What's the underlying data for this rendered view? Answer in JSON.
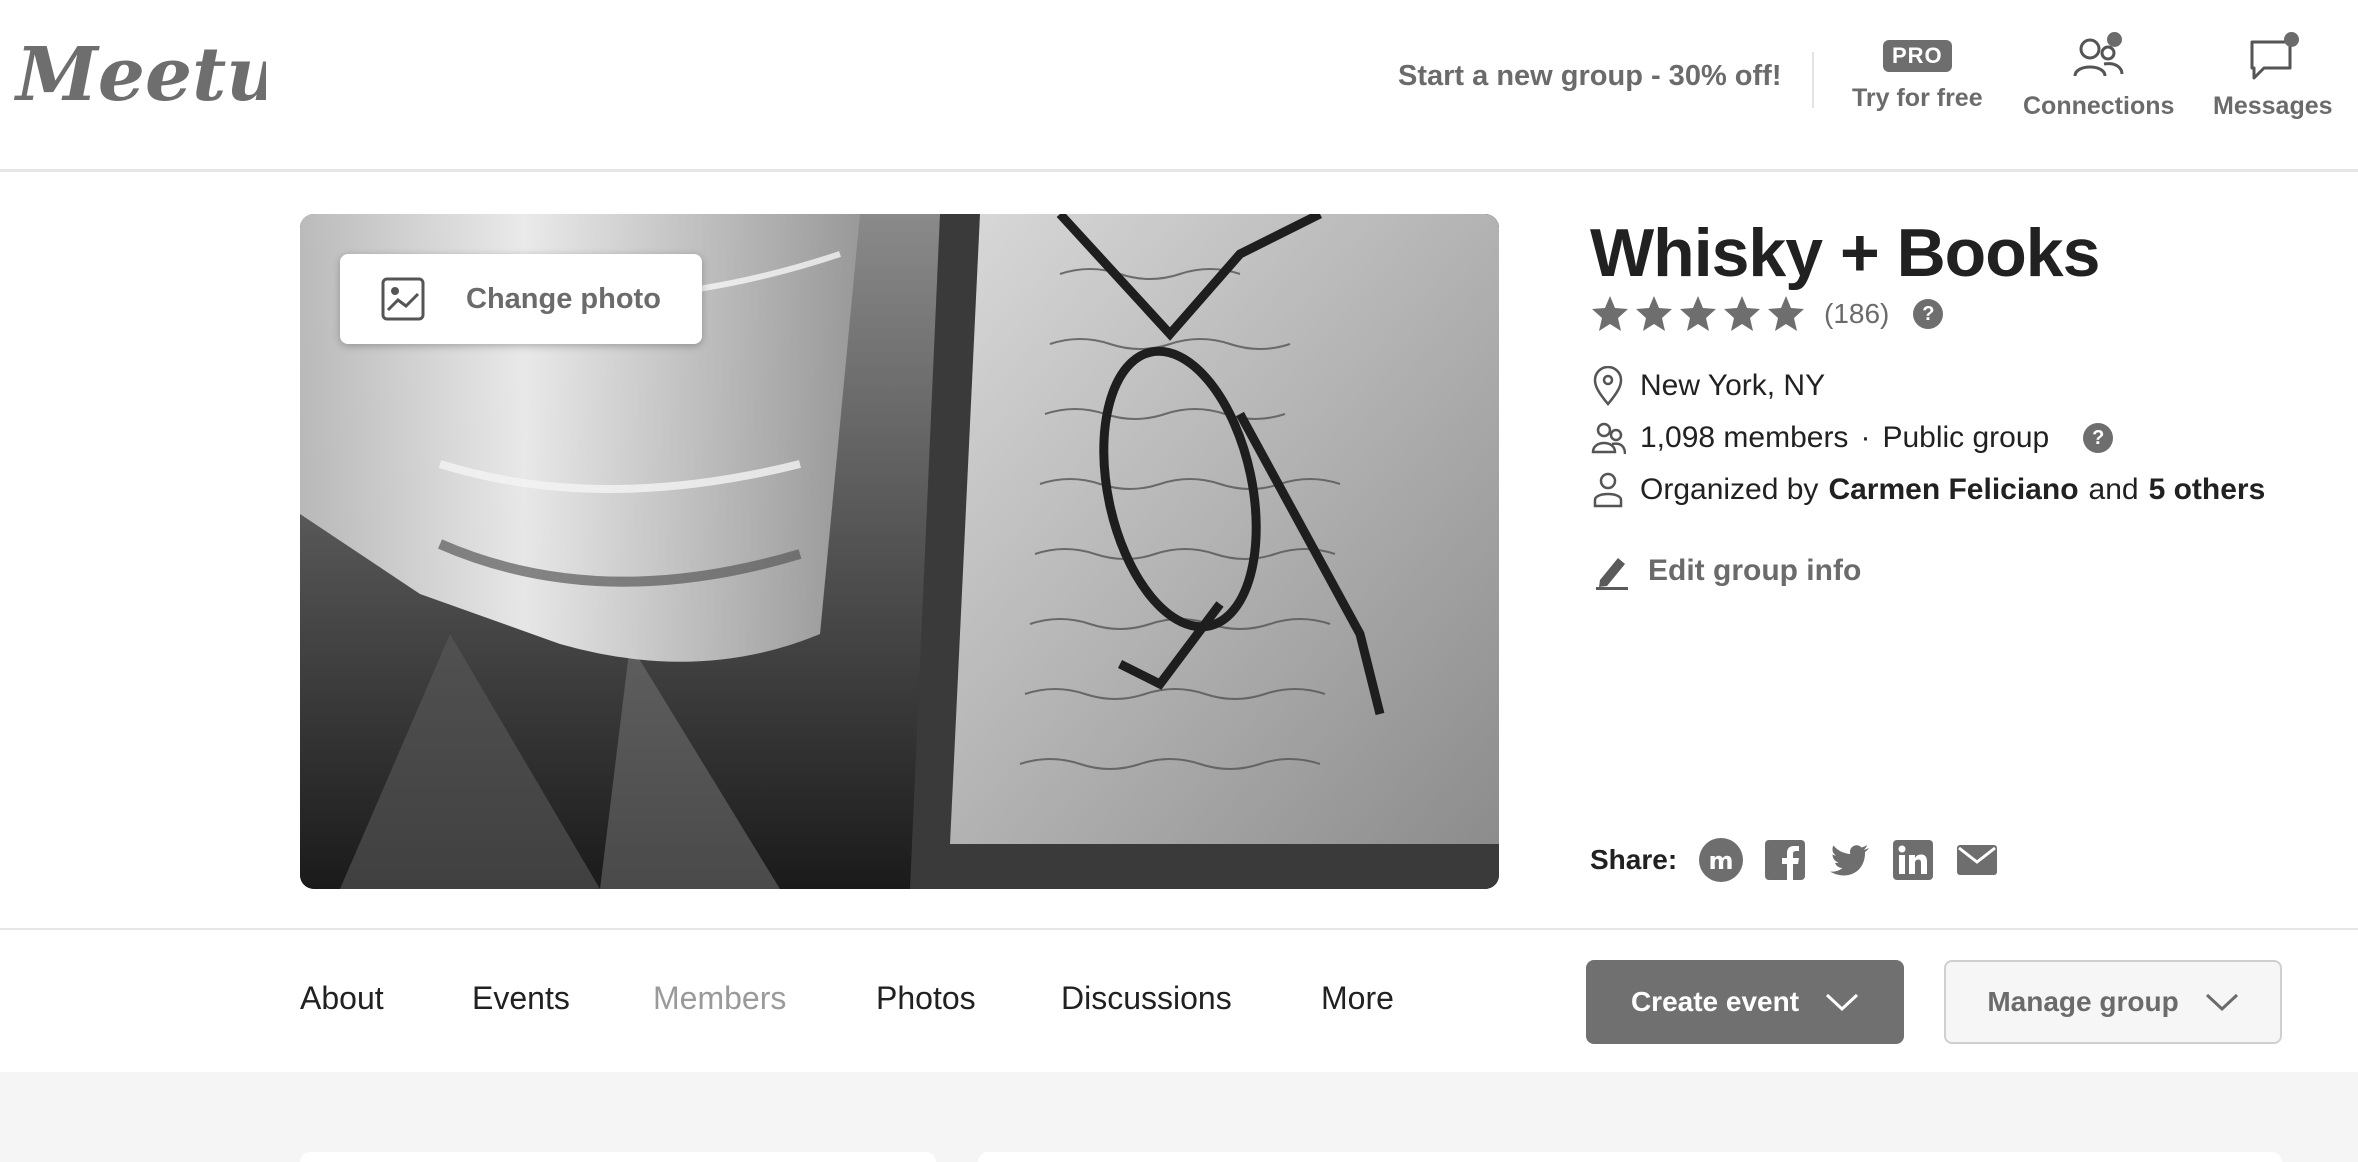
{
  "header": {
    "logo_text": "Meetup",
    "promo": "Start a new group - 30% off!",
    "pro_badge": "PRO",
    "try_label": "Try for free",
    "connections_label": "Connections",
    "messages_label": "Messages"
  },
  "hero": {
    "change_photo_label": "Change photo",
    "photo_subject": "glass-and-glasses-on-book"
  },
  "group": {
    "title": "Whisky + Books",
    "rating_stars": 5,
    "rating_count": "(186)",
    "help_symbol": "?",
    "location": "New York, NY",
    "members": "1,098 members",
    "separator": "·",
    "visibility": "Public group",
    "organized_prefix": "Organized by",
    "organizer": "Carmen Feliciano",
    "organized_and": "and",
    "others": "5 others",
    "edit_label": "Edit group info"
  },
  "share": {
    "label": "Share:",
    "icons": [
      "meetup-icon",
      "facebook-icon",
      "twitter-icon",
      "linkedin-icon",
      "email-icon"
    ]
  },
  "tabs": [
    {
      "label": "About",
      "active": false
    },
    {
      "label": "Events",
      "active": false
    },
    {
      "label": "Members",
      "active": true
    },
    {
      "label": "Photos",
      "active": false
    },
    {
      "label": "Discussions",
      "active": false
    },
    {
      "label": "More",
      "active": false
    }
  ],
  "actions": {
    "create_label": "Create event",
    "manage_label": "Manage group"
  },
  "colors": {
    "accent_gray": "#707070",
    "text_dark": "#212121",
    "text_muted": "#6b6b6b",
    "active_tab": "#9a9a9a"
  }
}
